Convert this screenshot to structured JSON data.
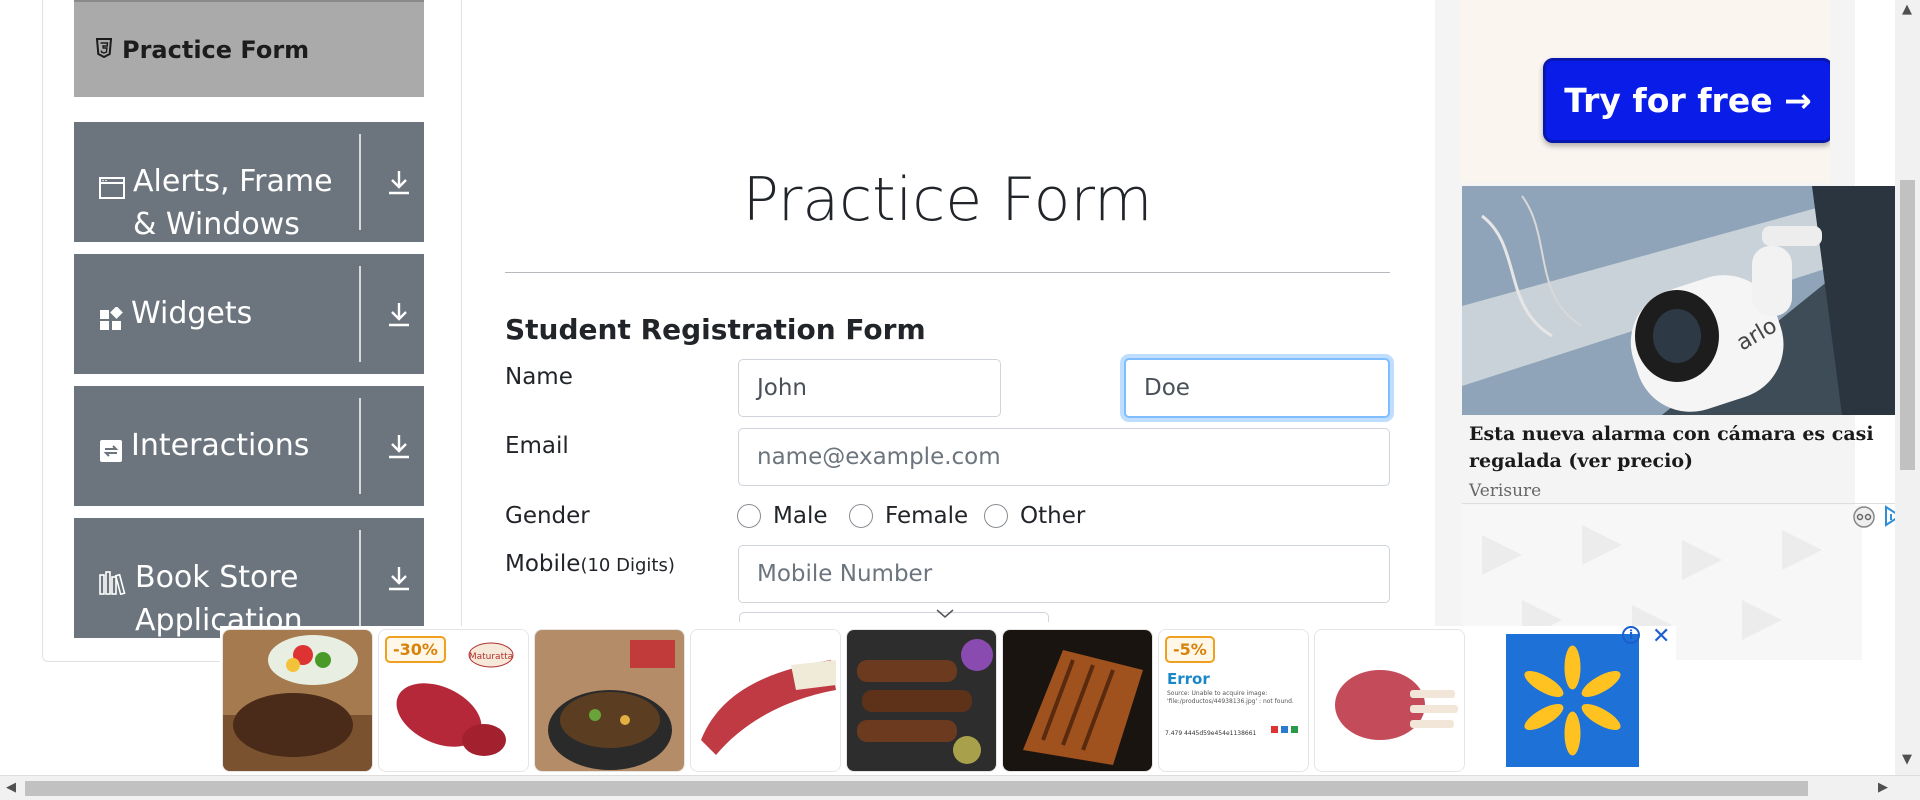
{
  "sidebar": {
    "active_item": {
      "label": "Practice Form",
      "icon": "html5-icon"
    },
    "groups": [
      {
        "label": "Alerts, Frame & Windows",
        "icon": "window-icon"
      },
      {
        "label": "Widgets",
        "icon": "widgets-icon"
      },
      {
        "label": "Interactions",
        "icon": "interactions-icon"
      },
      {
        "label": "Book Store Application",
        "icon": "books-icon"
      }
    ]
  },
  "main": {
    "title": "Practice Form",
    "form_heading": "Student Registration Form",
    "name_label": "Name",
    "first_name_value": "John",
    "last_name_value": "Doe",
    "email_label": "Email",
    "email_placeholder": "name@example.com",
    "gender_label": "Gender",
    "gender_options": [
      "Male",
      "Female",
      "Other"
    ],
    "mobile_label": "Mobile",
    "mobile_hint": "(10 Digits)",
    "mobile_placeholder": "Mobile Number"
  },
  "right_ad": {
    "button_label": "Try for free →",
    "caption": "Esta nueva alarma con cámara es casi regalada (ver precio)",
    "source": "Verisure",
    "brand_text": "arlo"
  },
  "banner_ad": {
    "badges": [
      "-30%",
      "-5%"
    ],
    "thumb_brand": "Maturatta",
    "error_title": "Error",
    "error_body": "Source: Unable to acquire image: 'file:/productos/44938136.jpg' : not found.",
    "error_code": "7.479 4445d59e454e1138661"
  },
  "colors": {
    "sidebar_group_bg": "#6c757d",
    "active_item_bg": "#aaaaaa",
    "focus_border": "#80bdff",
    "cta_blue": "#0a1de8",
    "walmart_blue": "#1e71d6",
    "walmart_yellow": "#ffc220"
  }
}
